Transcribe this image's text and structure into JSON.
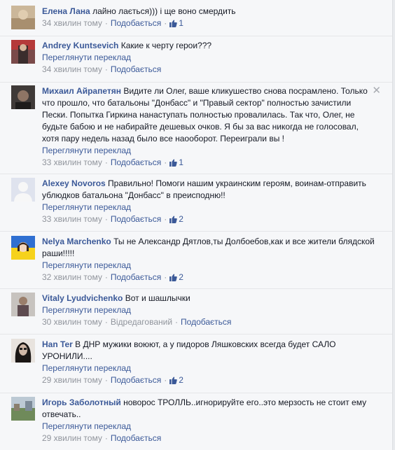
{
  "comments": [
    {
      "author": "Елена Лана",
      "text": "лайно лається))) і ще воно смердить",
      "translate": "",
      "time": "34 хвилин тому",
      "like": "Подобається",
      "likes": "1",
      "edited": "",
      "avatar_icon": "avatar-photo-icon"
    },
    {
      "author": "Andrey Kuntsevich",
      "text": "Какие к черту герои???",
      "translate": "Переглянути переклад",
      "time": "34 хвилин тому",
      "like": "Подобається",
      "likes": "",
      "edited": "",
      "avatar_icon": "avatar-photo-icon"
    },
    {
      "author": "Михаил Айрапетян",
      "text": "Видите ли Олег, ваше кликушество снова посрамлено. Только что прошло, что батальоны \"Донбасс\" и \"Правый сектор\" полностью зачистили Пески. Попытка Гиркина нанаступать полностью провалилась. Так что, Олег, не будьте бабою и не набирайте дешевых очков. Я бы за вас никогда не голосовал, хотя пару недель назад было все наооборот. Переиграли вы !",
      "translate": "Переглянути переклад",
      "time": "33 хвилин тому",
      "like": "Подобається",
      "likes": "1",
      "edited": "",
      "avatar_icon": "avatar-photo-icon",
      "close": "✕"
    },
    {
      "author": "Alexey Novoros",
      "text": "Правильно! Помоги нашим украинским героям, воинам-отправить ублюдков батальона \"Донбасс\" в преисподню!!",
      "translate": "Переглянути переклад",
      "time": "33 хвилин тому",
      "like": "Подобається",
      "likes": "2",
      "edited": "",
      "avatar_icon": "default-avatar-icon"
    },
    {
      "author": "Nelya Marchenko",
      "text": "Ты не Александр Дятлов,ты Долбоебов,как и все жители блядской раши!!!!!",
      "translate": "Переглянути переклад",
      "time": "32 хвилин тому",
      "like": "Подобається",
      "likes": "2",
      "edited": "",
      "avatar_icon": "avatar-photo-icon"
    },
    {
      "author": "Vitaly Lyudvichenko",
      "text": "Вот и шашлычки",
      "translate": "Переглянути переклад",
      "time": "30 хвилин тому",
      "like": "Подобається",
      "likes": "",
      "edited": "Відредагований",
      "avatar_icon": "avatar-photo-icon"
    },
    {
      "author": "Han Ter",
      "text": "В ДНР мужики воюют, а у пидоров Ляшковских всегда будет САЛО УРОНИЛИ....",
      "translate": "Переглянути переклад",
      "time": "29 хвилин тому",
      "like": "Подобається",
      "likes": "2",
      "edited": "",
      "avatar_icon": "avatar-photo-icon"
    },
    {
      "author": "Игорь Заболотный",
      "text": "новорос ТРОЛЛЬ..игнорируйте его..это мерзость не стоит ему отвечать..",
      "translate": "Переглянути переклад",
      "time": "29 хвилин тому",
      "like": "Подобається",
      "likes": "",
      "edited": "",
      "avatar_icon": "avatar-photo-icon"
    }
  ],
  "colors": {
    "link": "#3b5998",
    "meta": "#90949c",
    "text": "#141823",
    "background": "#f6f7f9"
  }
}
